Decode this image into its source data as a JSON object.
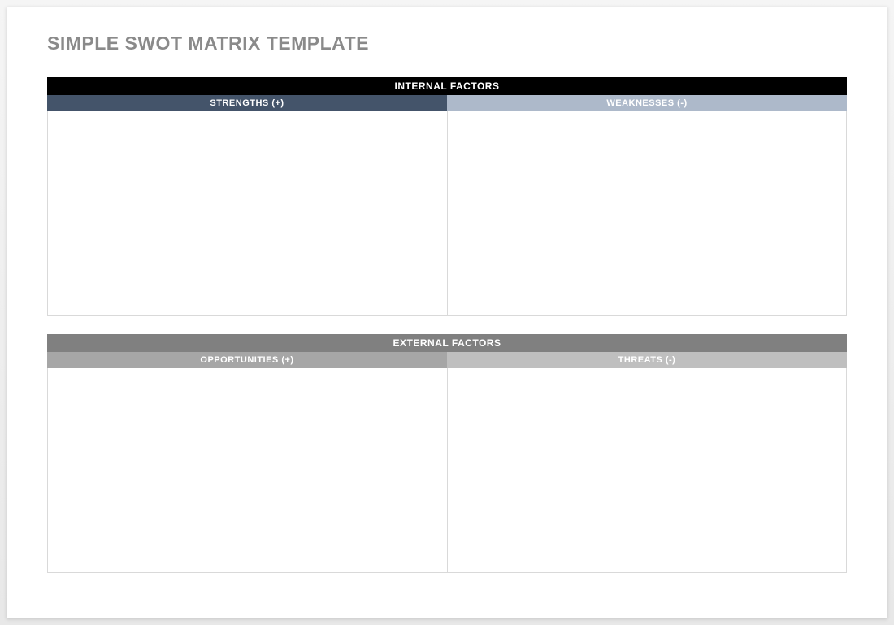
{
  "title": "SIMPLE SWOT MATRIX TEMPLATE",
  "internal": {
    "header": "INTERNAL FACTORS",
    "strengths_label": "STRENGTHS (+)",
    "weaknesses_label": "WEAKNESSES (-)",
    "strengths_content": "",
    "weaknesses_content": ""
  },
  "external": {
    "header": "EXTERNAL FACTORS",
    "opportunities_label": "OPPORTUNITIES (+)",
    "threats_label": "THREATS (-)",
    "opportunities_content": "",
    "threats_content": ""
  }
}
